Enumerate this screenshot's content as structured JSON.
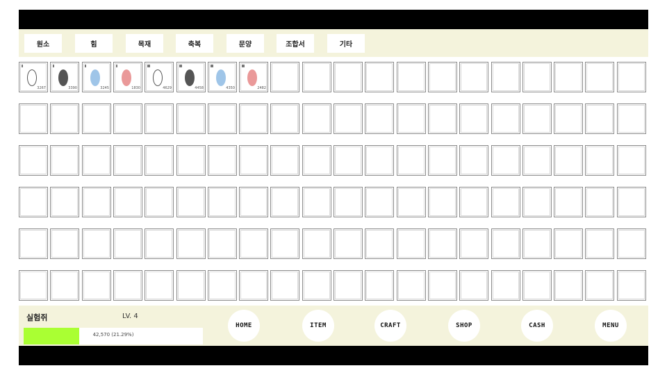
{
  "tabs": [
    {
      "label": "원소"
    },
    {
      "label": "힘"
    },
    {
      "label": "목재"
    },
    {
      "label": "축복"
    },
    {
      "label": "문양"
    },
    {
      "label": "조합서"
    },
    {
      "label": "기타"
    }
  ],
  "inventory": {
    "columns": 20,
    "rows": 6,
    "items": [
      {
        "count": "3267",
        "egg_color": "#ffffff",
        "egg_style": "outline",
        "tier": "I"
      },
      {
        "count": "3390",
        "egg_color": "#555555",
        "egg_style": "filled",
        "tier": "I"
      },
      {
        "count": "3245",
        "egg_color": "#9fc5e8",
        "egg_style": "filled",
        "tier": "I"
      },
      {
        "count": "1830",
        "egg_color": "#ea9999",
        "egg_style": "filled",
        "tier": "I"
      },
      {
        "count": "4629",
        "egg_color": "#ffffff",
        "egg_style": "outline",
        "tier": "II"
      },
      {
        "count": "4458",
        "egg_color": "#555555",
        "egg_style": "filled",
        "tier": "II"
      },
      {
        "count": "4350",
        "egg_color": "#9fc5e8",
        "egg_style": "filled",
        "tier": "II"
      },
      {
        "count": "2482",
        "egg_color": "#ea9999",
        "egg_style": "filled",
        "tier": "II"
      }
    ]
  },
  "player": {
    "name": "실험쥐",
    "level": "LV. 4",
    "xp_text": "42,570 (21.29%)",
    "xp_fraction": 0.2129,
    "xp_color": "#aaff33"
  },
  "nav": [
    {
      "label": "HOME"
    },
    {
      "label": "ITEM"
    },
    {
      "label": "CRAFT"
    },
    {
      "label": "SHOP"
    },
    {
      "label": "CASH"
    },
    {
      "label": "MENU"
    }
  ],
  "colors": {
    "panel": "#f4f3dc",
    "frame": "#000000"
  }
}
